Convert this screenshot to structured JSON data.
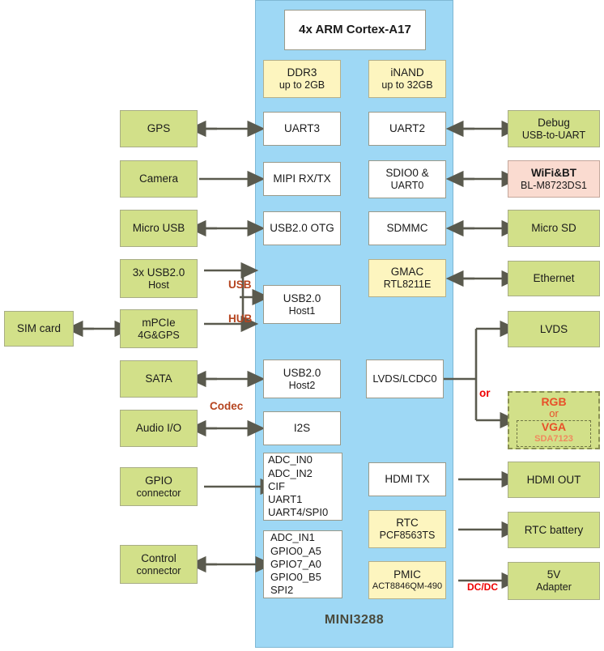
{
  "diagram": {
    "title": "MINI3288",
    "soc_label": "MINI3288",
    "colors": {
      "soc_panel": "#9ed8f5",
      "peripheral_green": "#d2e089",
      "memory_yellow": "#fdf5bf",
      "wifi_pink": "#fadbd0",
      "interface_white": "#ffffff",
      "arrow_gray": "#5a5a4e",
      "label_brown": "#b5441f",
      "label_red": "#ee0000",
      "rgb_orange": "#e8502a"
    }
  },
  "soc_blocks": {
    "cpu": {
      "l1": "4x ARM Cortex-A17"
    },
    "ddr3": {
      "l1": "DDR3",
      "l2": "up to 2GB"
    },
    "inand": {
      "l1": "iNAND",
      "l2": "up to 32GB"
    },
    "uart3": {
      "l1": "UART3"
    },
    "mipi": {
      "l1": "MIPI RX/TX"
    },
    "usb_otg": {
      "l1": "USB2.0 OTG"
    },
    "usb_host1": {
      "l1": "USB2.0",
      "l2": "Host1"
    },
    "usb_host2": {
      "l1": "USB2.0",
      "l2": "Host2"
    },
    "i2s": {
      "l1": "I2S"
    },
    "uart2": {
      "l1": "UART2"
    },
    "sdio0": {
      "l1": "SDIO0 &",
      "l2": "UART0"
    },
    "sdmmc": {
      "l1": "SDMMC"
    },
    "gmac": {
      "l1": "GMAC",
      "l2": "RTL8211E"
    },
    "lvds_lcdc0": {
      "l1": "LVDS/LCDC0"
    },
    "hdmi_tx": {
      "l1": "HDMI TX"
    },
    "rtc": {
      "l1": "RTC",
      "l2": "PCF8563TS"
    },
    "pmic": {
      "l1": "PMIC",
      "l2": "ACT8846QM-490"
    },
    "gpio_signals": {
      "lines": [
        "ADC_IN0",
        "ADC_IN2",
        "CIF",
        "UART1",
        "UART4/SPI0"
      ]
    },
    "control_signals": {
      "lines": [
        "ADC_IN1",
        "GPIO0_A5",
        "GPIO7_A0",
        "GPIO0_B5",
        "SPI2"
      ]
    }
  },
  "left_peripherals": {
    "gps": {
      "l1": "GPS"
    },
    "camera": {
      "l1": "Camera"
    },
    "micro_usb": {
      "l1": "Micro USB"
    },
    "usb_host_3x": {
      "l1": "3x USB2.0",
      "l2": "Host"
    },
    "mpcie": {
      "l1": "mPCIe",
      "l2": "4G&GPS"
    },
    "sim_card": {
      "l1": "SIM card"
    },
    "sata": {
      "l1": "SATA"
    },
    "audio_io": {
      "l1": "Audio I/O"
    },
    "gpio_connector": {
      "l1": "GPIO",
      "l2": "connector"
    },
    "control_connector": {
      "l1": "Control",
      "l2": "connector"
    }
  },
  "right_peripherals": {
    "debug": {
      "l1": "Debug",
      "l2": "USB-to-UART"
    },
    "wifi_bt": {
      "l1": "WiFi&BT",
      "l2": "BL-M8723DS1"
    },
    "micro_sd": {
      "l1": "Micro SD"
    },
    "ethernet": {
      "l1": "Ethernet"
    },
    "lvds": {
      "l1": "LVDS"
    },
    "rgb_vga": {
      "rgb": "RGB",
      "or": "or",
      "vga": "VGA",
      "part": "SDA7123"
    },
    "hdmi_out": {
      "l1": "HDMI OUT"
    },
    "rtc_battery": {
      "l1": "RTC battery"
    },
    "adapter_5v": {
      "l1": "5V",
      "l2": "Adapter"
    }
  },
  "bus_labels": {
    "usb": "USB",
    "hub": "HUB",
    "codec": "Codec",
    "or": "or",
    "dcdc": "DC/DC"
  }
}
